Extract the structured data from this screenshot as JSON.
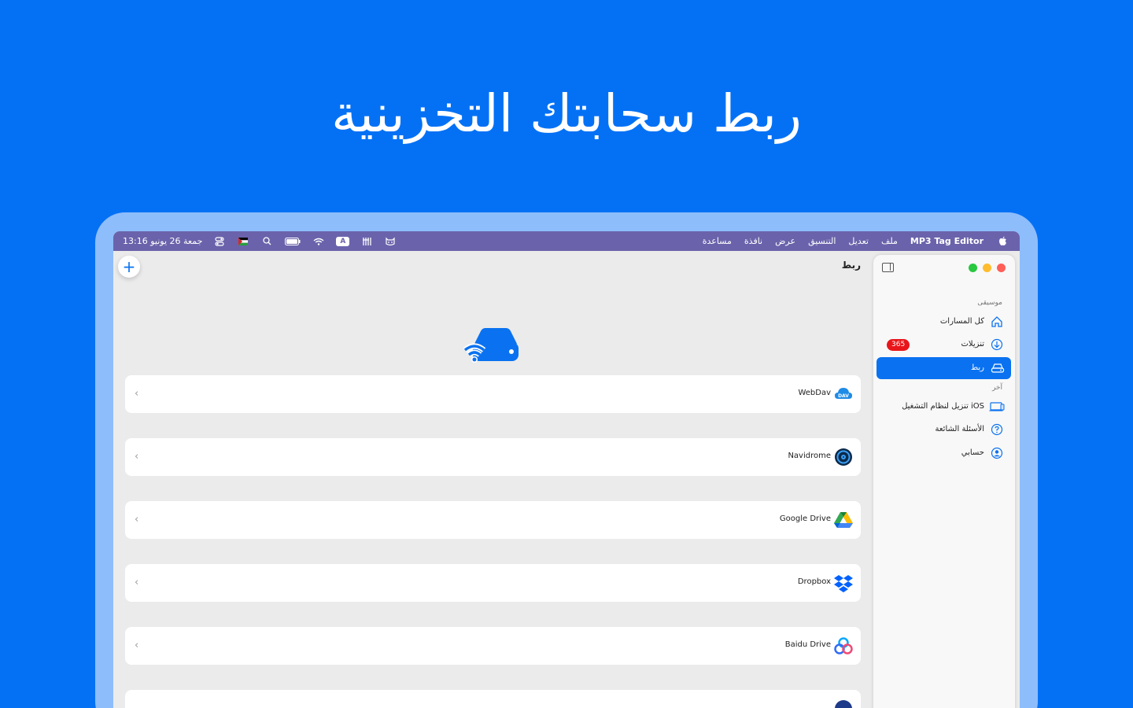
{
  "headline": "ربط سحابتك التخزينية",
  "menubar": {
    "app_name": "MP3 Tag Editor",
    "menus": [
      "ملف",
      "تعديل",
      "التنسيق",
      "عرض",
      "نافذة",
      "مساعدة"
    ],
    "clock": "جمعة 26 يونيو  13:16",
    "input_source": "A"
  },
  "main": {
    "title": "ربط",
    "add_label": "+",
    "services": [
      {
        "label": "WebDav",
        "icon": "webdav-icon"
      },
      {
        "label": "Navidrome",
        "icon": "navidrome-icon"
      },
      {
        "label": "Google Drive",
        "icon": "google-drive-icon"
      },
      {
        "label": "Dropbox",
        "icon": "dropbox-icon"
      },
      {
        "label": "Baidu Drive",
        "icon": "baidu-drive-icon"
      }
    ],
    "chevron": "‹"
  },
  "sidebar": {
    "section_music": "موسيقى",
    "section_other": "آخر",
    "items": [
      {
        "label": "كل المسارات",
        "icon": "home-icon"
      },
      {
        "label": "تنزيلات",
        "icon": "download-icon",
        "badge": "365"
      },
      {
        "label": "ربط",
        "icon": "drive-icon",
        "active": true
      },
      {
        "label": "تنزيل لنظام التشغيل iOS",
        "icon": "laptop-icon"
      },
      {
        "label": "الأسئلة الشائعة",
        "icon": "question-icon"
      },
      {
        "label": "حسابي",
        "icon": "account-icon"
      }
    ]
  },
  "colors": {
    "background": "#0471f5",
    "accent": "#0a72f0",
    "menubar": "#6a63ab",
    "badge": "#e8161b"
  }
}
